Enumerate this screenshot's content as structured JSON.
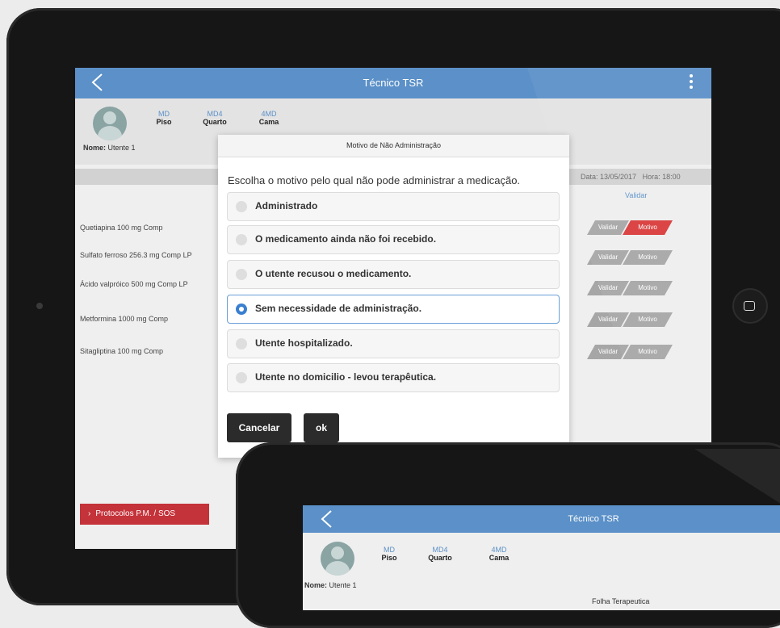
{
  "app": {
    "title": "Técnico TSR"
  },
  "patient": {
    "fields": [
      {
        "value": "MD",
        "label": "Piso"
      },
      {
        "value": "MD4",
        "label": "Quarto"
      },
      {
        "value": "4MD",
        "label": "Cama"
      }
    ],
    "nome_label": "Nome:",
    "nome_value": "Utente 1"
  },
  "header_bar": {
    "date": "Data: 13/05/2017",
    "hour": "Hora: 18:00",
    "validar_col": "Validar"
  },
  "medications": [
    {
      "name": "Quetiapina 100 mg Comp",
      "validar": "Validar",
      "motivo": "Motivo",
      "motivo_active": true
    },
    {
      "name": "Sulfato ferroso 256.3 mg Comp LP",
      "validar": "Validar",
      "motivo": "Motivo",
      "motivo_active": false
    },
    {
      "name": "Ácido valpróico 500 mg Comp LP",
      "validar": "Validar",
      "motivo": "Motivo",
      "motivo_active": false
    },
    {
      "name": "Metformina 1000 mg Comp",
      "validar": "Validar",
      "motivo": "Motivo",
      "motivo_active": false
    },
    {
      "name": "Sitagliptina 100 mg Comp",
      "validar": "Validar",
      "motivo": "Motivo",
      "motivo_active": false
    }
  ],
  "protocols_button": "Protocolos P.M. / SOS",
  "dialog": {
    "title": "Motivo de Não Administração",
    "prompt": "Escolha o motivo pelo qual não pode administrar a medicação.",
    "options": [
      {
        "label": "Administrado",
        "selected": false
      },
      {
        "label": "O medicamento ainda não foi recebido.",
        "selected": false
      },
      {
        "label": "O utente recusou o medicamento.",
        "selected": false
      },
      {
        "label": "Sem necessidade de administração.",
        "selected": true
      },
      {
        "label": "Utente hospitalizado.",
        "selected": false
      },
      {
        "label": "Utente no domicilio - levou terapêutica.",
        "selected": false
      }
    ],
    "cancel_label": "Cancelar",
    "ok_label": "ok"
  },
  "second_screen": {
    "title": "Técnico TSR",
    "fields": [
      {
        "value": "MD",
        "label": "Piso"
      },
      {
        "value": "MD4",
        "label": "Quarto"
      },
      {
        "value": "4MD",
        "label": "Cama"
      }
    ],
    "nome_label": "Nome:",
    "nome_value": "Utente 1",
    "subtitle": "Folha Terapeutica"
  },
  "colors": {
    "topbar": "#5b90c8",
    "accent_red": "#d93a3a",
    "protocol_red": "#c4323a",
    "selected_radio": "#3a7fd0"
  },
  "icons": [
    "back-chevron-icon",
    "kebab-menu-icon",
    "avatar-icon",
    "home-button-icon",
    "chevron-right-icon"
  ]
}
